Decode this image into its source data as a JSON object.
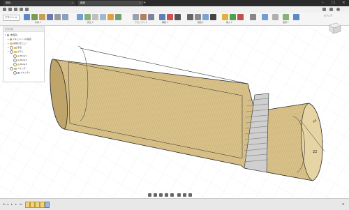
{
  "tabs": [
    {
      "label": "部品",
      "close": "×"
    },
    {
      "label": "部品",
      "close": "×"
    }
  ],
  "new_tab": "+",
  "window_controls": {
    "min": "–",
    "max": "□",
    "close": "×"
  },
  "workspace": {
    "label": "デザイン ▾"
  },
  "toolbar_groups": [
    "作成 ▾",
    "修正 ▾",
    "アセンブリ ▾",
    "構築 ▾",
    "検査 ▾",
    "挿入 ▾",
    "選択 ▾"
  ],
  "user": "ようこそ",
  "browser": {
    "header": "ブラウザ",
    "items": [
      {
        "label": "(未保存)"
      },
      {
        "label": "ドキュメントの設定"
      },
      {
        "label": "名前付きビュー"
      },
      {
        "label": "原点"
      },
      {
        "label": "ボディ"
      },
      {
        "label": "Body1"
      },
      {
        "label": "Body2"
      },
      {
        "label": "Body3"
      },
      {
        "label": "スケッチ"
      },
      {
        "label": "スケッチ1"
      }
    ]
  },
  "dimension": {
    "value": "22",
    "label": "直径"
  },
  "colors": {
    "part_body": "#d9c28a",
    "part_edge": "#2a2a2a",
    "hatch": "#b89d5c",
    "thread": "#cfcfcf",
    "grid": "#e6e6e6"
  }
}
